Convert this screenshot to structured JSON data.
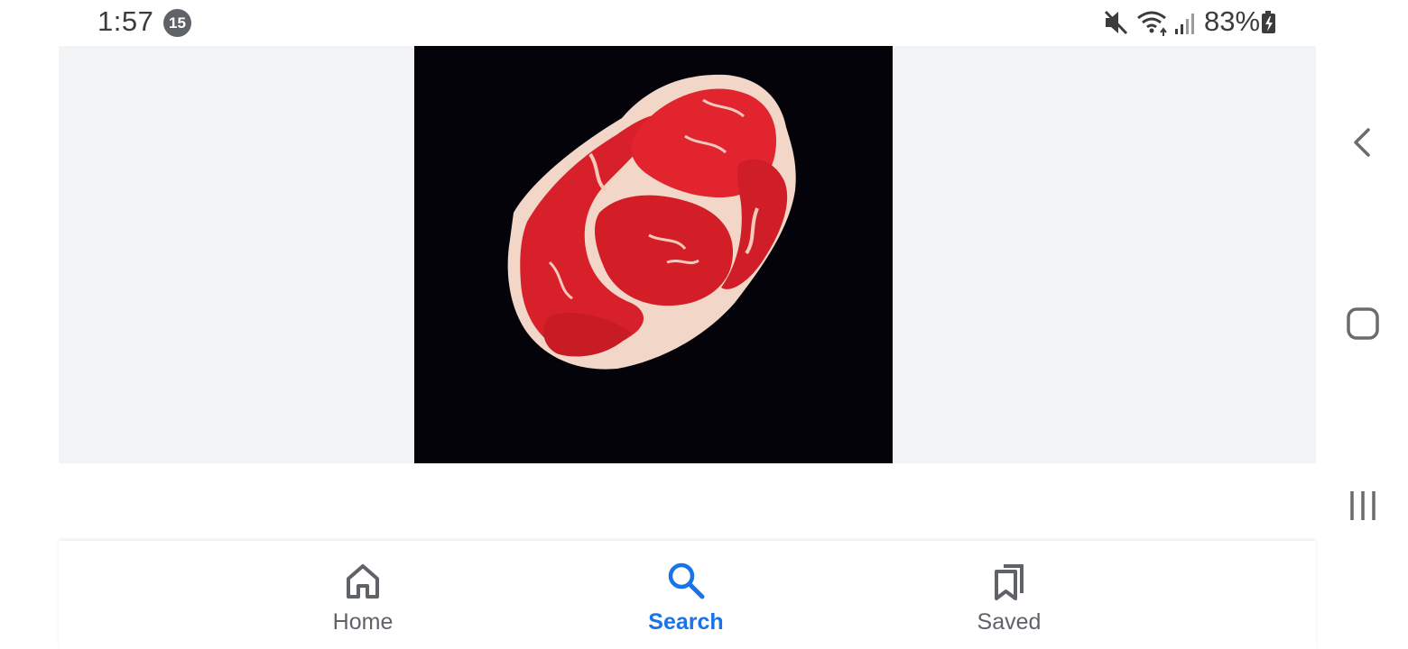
{
  "status_bar": {
    "time": "1:57",
    "notification_count": "15",
    "battery": "83%",
    "icons": [
      "mute-icon",
      "wifi-icon",
      "signal-icon",
      "battery-charging-icon"
    ]
  },
  "viewer": {
    "image_subject": "raw ribeye steak",
    "background_color": "#f1f3f4",
    "image_background_color": "#04030a"
  },
  "bottom_nav": {
    "items": [
      {
        "label": "Home",
        "icon": "home-icon",
        "active": false
      },
      {
        "label": "Search",
        "icon": "search-icon",
        "active": true
      },
      {
        "label": "Saved",
        "icon": "bookmarks-icon",
        "active": false
      }
    ],
    "active_color": "#1a73e8",
    "inactive_color": "#5f6368"
  },
  "system_nav": {
    "buttons": [
      "back-icon",
      "home-square-icon",
      "recents-icon"
    ]
  }
}
